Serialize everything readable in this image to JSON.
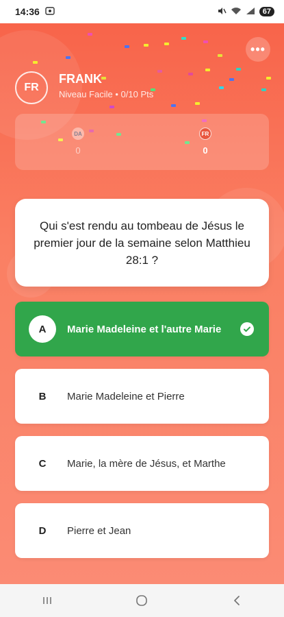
{
  "status_bar": {
    "time": "14:36",
    "battery": "67"
  },
  "player": {
    "initials": "FR",
    "name": "FRANK",
    "subtitle": "Niveau Facile • 0/10 Pts"
  },
  "scoreboard": {
    "left_team": {
      "badge": "DA",
      "score": "0"
    },
    "right_team": {
      "badge": "FR",
      "score": "0"
    }
  },
  "question": {
    "text": "Qui s'est rendu au tombeau de Jésus le premier jour de la semaine selon Matthieu 28:1 ?"
  },
  "answers": [
    {
      "letter": "A",
      "text": "Marie Madeleine et l'autre Marie",
      "state": "correct"
    },
    {
      "letter": "B",
      "text": "Marie Madeleine et Pierre",
      "state": "default"
    },
    {
      "letter": "C",
      "text": "Marie, la mère de Jésus, et Marthe",
      "state": "default"
    },
    {
      "letter": "D",
      "text": "Pierre et Jean",
      "state": "default"
    }
  ],
  "colors": {
    "accent": "#f8644a",
    "correct": "#31a64b"
  },
  "icons": {
    "menu": "more-horizontal-icon",
    "check": "check-circle-icon",
    "nav_recents": "recents-icon",
    "nav_home": "home-icon",
    "nav_back": "back-icon"
  }
}
